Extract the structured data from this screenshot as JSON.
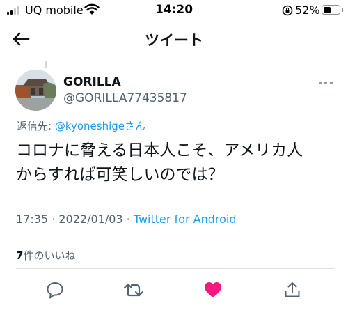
{
  "status_bar": {
    "carrier": "UQ mobile",
    "time": "14:20",
    "battery_percent_text": "52%",
    "battery_level": 0.52,
    "signal_bars_active": 2,
    "signal_bars_total": 4
  },
  "nav": {
    "title": "ツイート",
    "back_icon": "arrow-left-icon"
  },
  "tweet": {
    "display_name": "GORILLA",
    "handle": "@GORILLA77435817",
    "reply_prefix": "返信先: ",
    "reply_mention": "@kyoneshige",
    "reply_suffix": "さん",
    "text_line1": "コロナに脅える日本人こそ、アメリカ人",
    "text_line2": "からすれば可笑しいのでは？",
    "timestamp": "17:35 · 2022/01/03 · ",
    "source": "Twitter for Android",
    "likes_number": "7",
    "likes_label": "件のいいね"
  },
  "actions": [
    "reply-icon",
    "retweet-icon",
    "like-icon",
    "share-icon"
  ],
  "colors": {
    "accent": "#1d9bf0",
    "like": "#f91880",
    "muted_text": "#536471"
  }
}
